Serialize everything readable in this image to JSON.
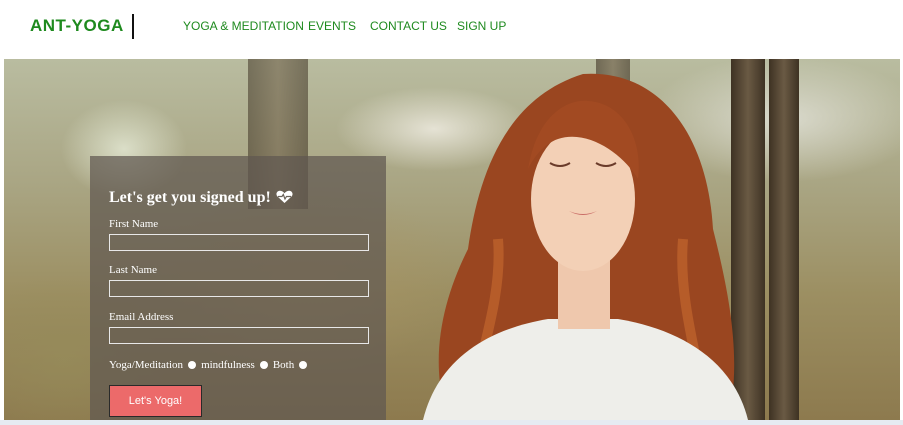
{
  "brand": {
    "name": "ANT-YOGA",
    "color": "#1e8a1e"
  },
  "nav": {
    "links": [
      {
        "label": "YOGA & MEDITATION"
      },
      {
        "label": "EVENTS"
      },
      {
        "label": "CONTACT US"
      },
      {
        "label": "SIGN UP"
      }
    ]
  },
  "form": {
    "title": "Let's get you signed up!",
    "title_icon": "heartbeat-icon",
    "fields": [
      {
        "label": "First Name",
        "value": ""
      },
      {
        "label": "Last Name",
        "value": ""
      },
      {
        "label": "Email Address",
        "value": ""
      }
    ],
    "radio_options": [
      {
        "label": "Yoga/Meditation"
      },
      {
        "label": "mindfulness"
      },
      {
        "label": "Both"
      }
    ],
    "submit_label": "Let's Yoga!",
    "submit_color": "#ec6a6a"
  }
}
